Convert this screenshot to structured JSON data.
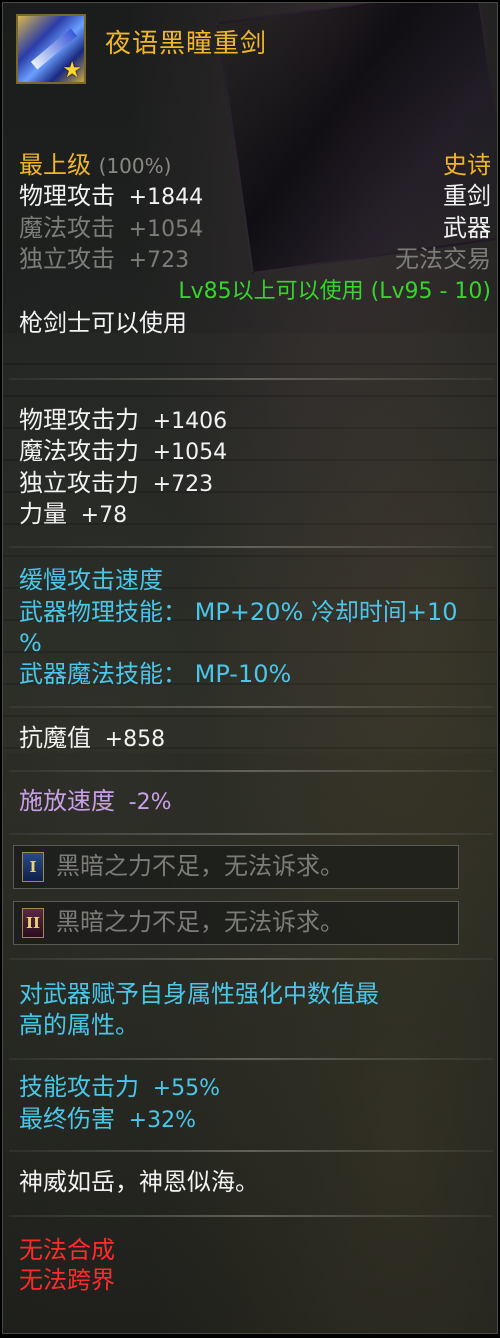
{
  "item": {
    "name": "夜语黑瞳重剑",
    "grade": "最上级",
    "grade_pct": "(100%)",
    "rarity": "史诗",
    "weapon_type": "重剑",
    "category": "武器",
    "trade": "无法交易",
    "requirement": "Lv85以上可以使用 (Lv95 - 10)",
    "class_req": "枪剑士可以使用"
  },
  "base_stats": [
    {
      "label": "物理攻击",
      "value": "+1844"
    },
    {
      "label": "魔法攻击",
      "value": "+1054"
    },
    {
      "label": "独立攻击",
      "value": "+723"
    }
  ],
  "attack_stats": [
    {
      "label": "物理攻击力",
      "value": "+1406"
    },
    {
      "label": "魔法攻击力",
      "value": "+1054"
    },
    {
      "label": "独立攻击力",
      "value": "+723"
    },
    {
      "label": "力量",
      "value": "+78"
    }
  ],
  "speed_section": {
    "line1": "缓慢攻击速度",
    "line2": "武器物理技能： MP+20% 冷却时间+10",
    "line3": "%",
    "line4": "武器魔法技能： MP-10%"
  },
  "resist": {
    "label": "抗魔值",
    "value": "+858"
  },
  "cast_speed": {
    "label": "施放速度",
    "value": "-2%"
  },
  "slots": [
    {
      "badge": "I",
      "text": "黑暗之力不足，无法诉求。"
    },
    {
      "badge": "II",
      "text": "黑暗之力不足，无法诉求。"
    }
  ],
  "enchant_desc": {
    "line1": "对武器赋予自身属性强化中数值最",
    "line2": "高的属性。"
  },
  "bonus_stats": [
    {
      "label": "技能攻击力",
      "value": "+55%"
    },
    {
      "label": "最终伤害",
      "value": "+32%"
    }
  ],
  "flavor": "神威如岳，神恩似海。",
  "restrictions": [
    "无法合成",
    "无法跨界"
  ],
  "colors": {
    "title": "#f0b72a",
    "requirement": "#35d52c",
    "skill": "#49c6e8",
    "cast": "#c9a0e6",
    "restriction": "#ff2b2b"
  }
}
